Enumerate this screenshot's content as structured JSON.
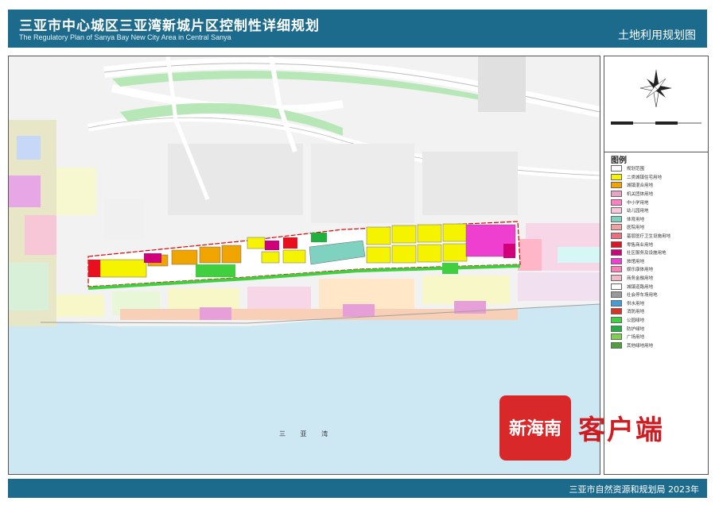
{
  "header": {
    "title_cn": "三亚市中心城区三亚湾新城片区控制性详细规划",
    "title_en": "The Regulatory Plan of Sanya Bay New City Area in Central Sanya",
    "map_type": "土地利用规划图"
  },
  "map": {
    "sea_label": "三  亚  湾"
  },
  "legend": {
    "title": "图例",
    "items": [
      {
        "label": "规划范围",
        "color": "#ffffff"
      },
      {
        "label": "二类城镇住宅用地",
        "color": "#f6f300"
      },
      {
        "label": "城镇混合用地",
        "color": "#f0a400"
      },
      {
        "label": "机关团体用地",
        "color": "#e8a2c3"
      },
      {
        "label": "中小学用地",
        "color": "#ff80c0"
      },
      {
        "label": "幼儿园用地",
        "color": "#f7c8da"
      },
      {
        "label": "体育用地",
        "color": "#7fd1c0"
      },
      {
        "label": "医院用地",
        "color": "#f2a0a0"
      },
      {
        "label": "基层医疗卫生设施用地",
        "color": "#e87080"
      },
      {
        "label": "零售商业用地",
        "color": "#e8101e"
      },
      {
        "label": "社区服务及设施用地",
        "color": "#d0007a"
      },
      {
        "label": "旅馆用地",
        "color": "#ee3fd0"
      },
      {
        "label": "娱乐康体用地",
        "color": "#ff7fb8"
      },
      {
        "label": "商务金融用地",
        "color": "#f4b8c8"
      },
      {
        "label": "城镇道路用地",
        "color": "#ffffff"
      },
      {
        "label": "社会停车场用地",
        "color": "#999999"
      },
      {
        "label": "供水用地",
        "color": "#3f9fd6"
      },
      {
        "label": "消防用地",
        "color": "#e03020"
      },
      {
        "label": "公园绿地",
        "color": "#3fcf3f"
      },
      {
        "label": "防护绿地",
        "color": "#20b040"
      },
      {
        "label": "广场用地",
        "color": "#7fd04f"
      },
      {
        "label": "其他绿地用地",
        "color": "#4f9f3f"
      }
    ]
  },
  "footer": {
    "org": "三亚市自然资源和规划局  2023年"
  },
  "watermark": {
    "logo_text": "新海南",
    "app_text": "客户端"
  },
  "colors": {
    "header_bg": "#1d6b8c",
    "sea": "#cde7f3",
    "residential": "#f6f300",
    "mixed": "#f0a400",
    "hotel": "#ee3fd0",
    "green": "#3fcf3f",
    "sports": "#7fd1c0"
  }
}
